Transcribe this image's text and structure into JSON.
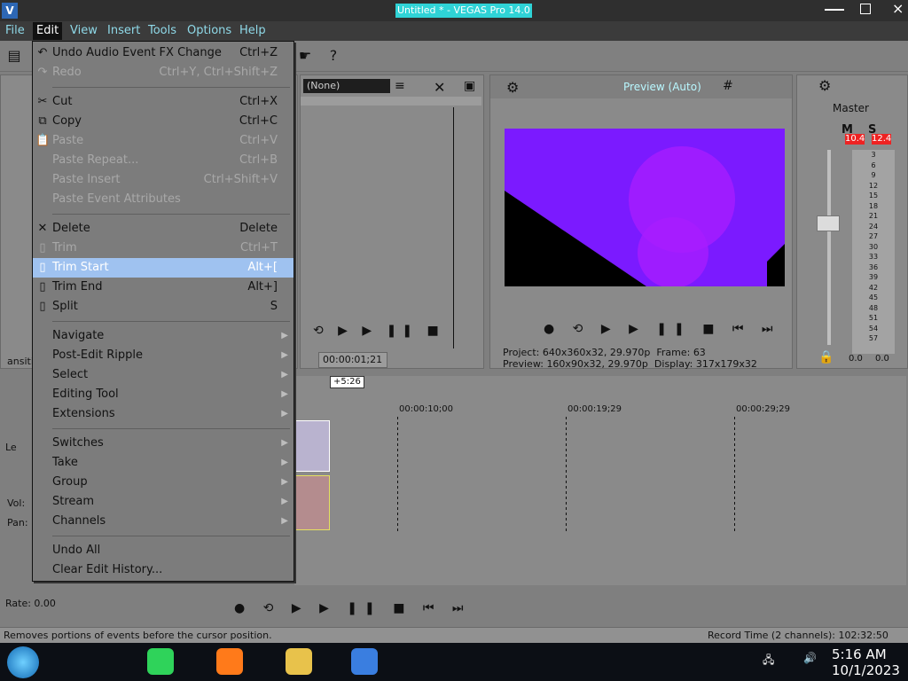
{
  "window": {
    "title": "Untitled * - VEGAS Pro 14.0",
    "logo": "vegas-logo",
    "controls": [
      "minimize-icon",
      "maximize-icon",
      "close-icon"
    ]
  },
  "menubar": {
    "items": [
      "File",
      "Edit",
      "View",
      "Insert",
      "Tools",
      "Options",
      "Help"
    ],
    "active": "Edit"
  },
  "edit_menu": {
    "items": [
      {
        "label": "Undo Audio Event FX Change",
        "shortcut": "Ctrl+Z",
        "enabled": true,
        "icon": "undo-icon"
      },
      {
        "label": "Redo",
        "shortcut": "Ctrl+Y, Ctrl+Shift+Z",
        "enabled": false,
        "icon": "redo-icon"
      },
      {
        "separator": true
      },
      {
        "label": "Cut",
        "shortcut": "Ctrl+X",
        "enabled": true,
        "icon": "scissors-icon"
      },
      {
        "label": "Copy",
        "shortcut": "Ctrl+C",
        "enabled": true,
        "icon": "copy-icon"
      },
      {
        "label": "Paste",
        "shortcut": "Ctrl+V",
        "enabled": false,
        "icon": "paste-icon"
      },
      {
        "label": "Paste Repeat...",
        "shortcut": "Ctrl+B",
        "enabled": false
      },
      {
        "label": "Paste Insert",
        "shortcut": "Ctrl+Shift+V",
        "enabled": false
      },
      {
        "label": "Paste Event Attributes",
        "shortcut": "",
        "enabled": false
      },
      {
        "separator": true
      },
      {
        "label": "Delete",
        "shortcut": "Delete",
        "enabled": true,
        "icon": "delete-icon"
      },
      {
        "label": "Trim",
        "shortcut": "Ctrl+T",
        "enabled": false,
        "icon": "trim-icon"
      },
      {
        "label": "Trim Start",
        "shortcut": "Alt+[",
        "enabled": true,
        "highlight": true,
        "icon": "trim-start-icon"
      },
      {
        "label": "Trim End",
        "shortcut": "Alt+]",
        "enabled": true,
        "icon": "trim-end-icon"
      },
      {
        "label": "Split",
        "shortcut": "S",
        "enabled": true,
        "icon": "split-icon"
      },
      {
        "separator": true
      },
      {
        "label": "Navigate",
        "submenu": true,
        "enabled": true
      },
      {
        "label": "Post-Edit Ripple",
        "submenu": true,
        "enabled": true
      },
      {
        "label": "Select",
        "submenu": true,
        "enabled": true
      },
      {
        "label": "Editing Tool",
        "submenu": true,
        "enabled": true
      },
      {
        "label": "Extensions",
        "submenu": true,
        "enabled": true
      },
      {
        "separator": true
      },
      {
        "label": "Switches",
        "submenu": true,
        "enabled": true
      },
      {
        "label": "Take",
        "submenu": true,
        "enabled": true
      },
      {
        "label": "Group",
        "submenu": true,
        "enabled": true
      },
      {
        "label": "Stream",
        "submenu": true,
        "enabled": true
      },
      {
        "label": "Channels",
        "submenu": true,
        "enabled": true
      },
      {
        "separator": true
      },
      {
        "label": "Undo All",
        "shortcut": "",
        "enabled": true
      },
      {
        "label": "Clear Edit History...",
        "shortcut": "",
        "enabled": true
      }
    ]
  },
  "trimmer": {
    "selector": "(None)",
    "timecode": "00:00:01;21"
  },
  "preview": {
    "mode": "Preview (Auto)",
    "project_label": "Project:",
    "project": "640x360x32, 29.970p",
    "frame_label": "Frame:",
    "frame": "63",
    "preview_label": "Preview:",
    "preview_res": "160x90x32, 29.970p",
    "display_label": "Display:",
    "display": "317x179x32"
  },
  "master": {
    "title": "Master",
    "mute": "M",
    "solo": "S",
    "peak_left": "10.4",
    "peak_right": "12.4",
    "scale": [
      "3",
      "6",
      "9",
      "12",
      "15",
      "18",
      "21",
      "24",
      "27",
      "30",
      "33",
      "36",
      "39",
      "42",
      "45",
      "48",
      "51",
      "54",
      "57"
    ],
    "level_left": "0.0",
    "level_right": "0.0"
  },
  "timeline": {
    "offset_label": "+5:26",
    "timecodes": [
      "00:00:10;00",
      "00:00:19;29",
      "00:00:29;29"
    ],
    "track_labels": {
      "video": "Le",
      "vol": "Vol:",
      "pan": "Pan:"
    },
    "left_label": "ansiti"
  },
  "rate": "Rate: 0.00",
  "status": {
    "message": "Removes portions of events before the cursor position.",
    "record": "Record Time (2 channels): 102:32:50"
  },
  "taskbar": {
    "time": "5:16 AM",
    "date": "10/1/2023"
  },
  "colors": {
    "menu_bg": "#7c7c7c",
    "highlight": "#9fc2f0",
    "preview_purple": "#7b1aff",
    "accent_cyan": "#2fd3d6",
    "meter_red": "#e22222"
  }
}
